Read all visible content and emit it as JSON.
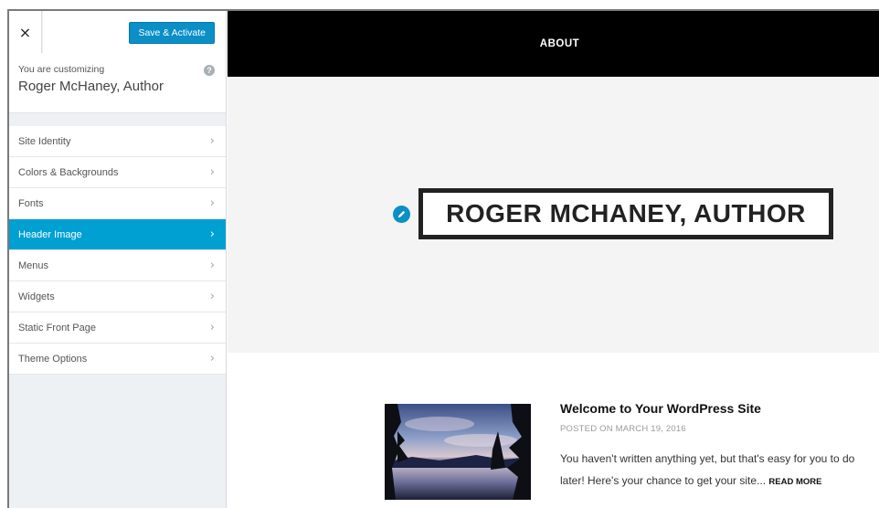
{
  "sidebar": {
    "close_label": "×",
    "save_label": "Save & Activate",
    "customizing_label": "You are customizing",
    "site_name": "Roger McHaney, Author",
    "help_label": "?",
    "items": [
      {
        "label": "Site Identity"
      },
      {
        "label": "Colors & Backgrounds"
      },
      {
        "label": "Fonts"
      },
      {
        "label": "Header Image",
        "active": true
      },
      {
        "label": "Menus"
      },
      {
        "label": "Widgets"
      },
      {
        "label": "Static Front Page"
      },
      {
        "label": "Theme Options"
      }
    ],
    "chevron": "›"
  },
  "preview": {
    "nav_items": [
      {
        "label": "ABOUT"
      }
    ],
    "site_title": "ROGER MCHANEY, AUTHOR",
    "post": {
      "title": "Welcome to Your WordPress Site",
      "meta": "POSTED ON MARCH 19, 2016",
      "excerpt": "You haven't written anything yet, but that's easy for you to do later! Here's your chance to get your site...",
      "read_more": "READ MORE"
    }
  },
  "colors": {
    "accent": "#00a0d2",
    "button": "#0a8fc7",
    "nav_bg": "#000000",
    "sidebar_bg": "#eef1f3"
  },
  "icons": [
    "close-icon",
    "help-icon",
    "chevron-right-icon",
    "edit-pencil-icon"
  ]
}
